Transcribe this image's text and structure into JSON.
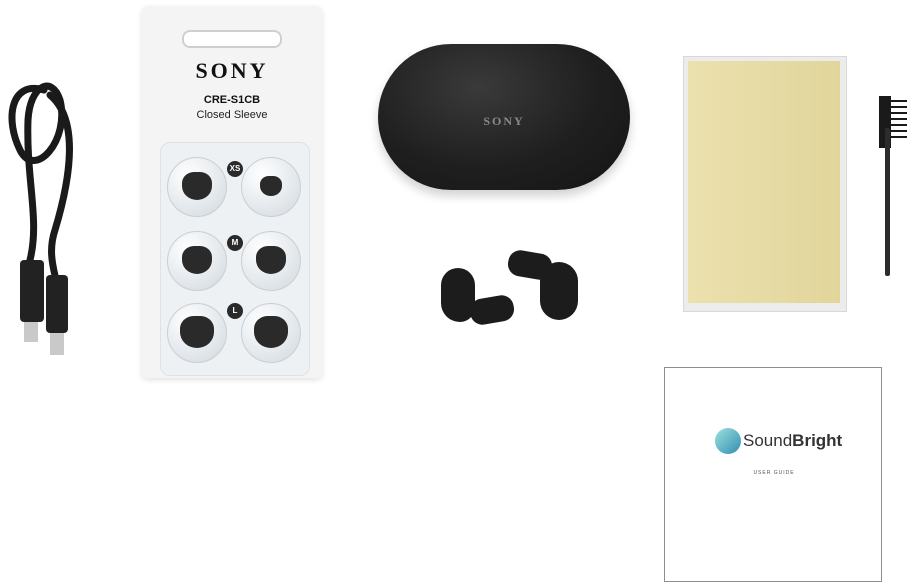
{
  "tip_card": {
    "brand": "SONY",
    "model": "CRE-S1CB",
    "description": "Closed Sleeve",
    "sizes": [
      "XS",
      "M",
      "L"
    ]
  },
  "case": {
    "brand": "SONY"
  },
  "user_guide": {
    "brand_light": "Sound",
    "brand_bold": "Bright",
    "subtitle": "USER GUIDE"
  },
  "colors": {
    "case": "#1f1f1f",
    "cloth": "#e8dca0",
    "guide_logo": "#2f8fb0"
  }
}
